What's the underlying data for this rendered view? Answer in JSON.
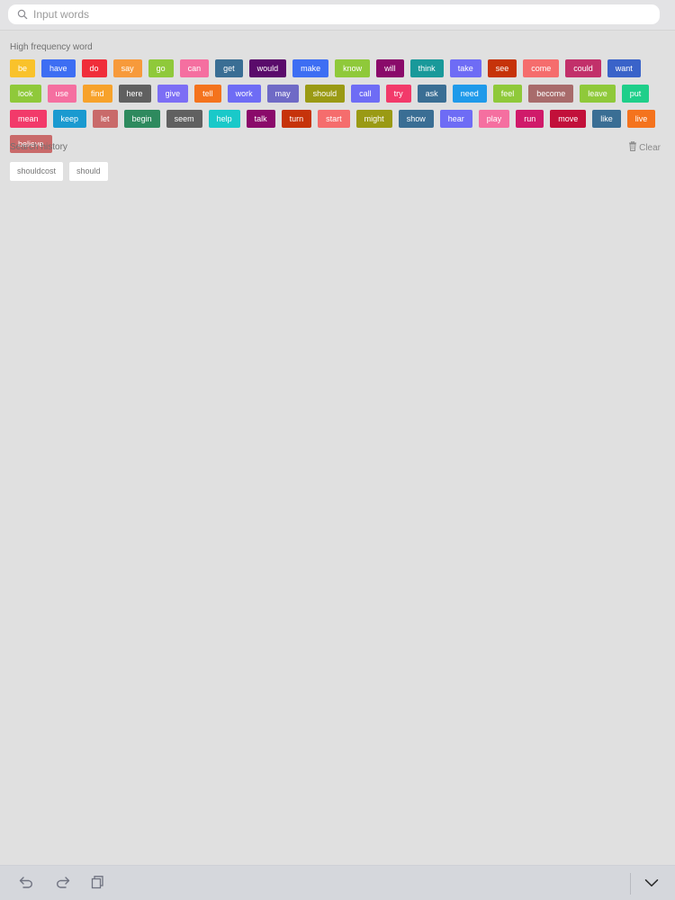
{
  "search": {
    "placeholder": "Input words",
    "value": ""
  },
  "high_frequency": {
    "title": "High frequency word",
    "words": [
      {
        "label": "be",
        "color": "#f9c22b"
      },
      {
        "label": "have",
        "color": "#3d6ef3"
      },
      {
        "label": "do",
        "color": "#f02e3a"
      },
      {
        "label": "say",
        "color": "#f79a3b"
      },
      {
        "label": "go",
        "color": "#8fc93a"
      },
      {
        "label": "can",
        "color": "#f56fa0"
      },
      {
        "label": "get",
        "color": "#3a6e94"
      },
      {
        "label": "would",
        "color": "#5a0b6b"
      },
      {
        "label": "make",
        "color": "#3d6ef3"
      },
      {
        "label": "know",
        "color": "#8fc93a"
      },
      {
        "label": "will",
        "color": "#8a0a6a"
      },
      {
        "label": "think",
        "color": "#19999a"
      },
      {
        "label": "take",
        "color": "#6e6cf5"
      },
      {
        "label": "see",
        "color": "#c6330a"
      },
      {
        "label": "come",
        "color": "#f56d6d"
      },
      {
        "label": "could",
        "color": "#c2306a"
      },
      {
        "label": "want",
        "color": "#3a63c9"
      },
      {
        "label": "look",
        "color": "#8fc93a"
      },
      {
        "label": "use",
        "color": "#f56fa0"
      },
      {
        "label": "find",
        "color": "#f7a22b"
      },
      {
        "label": "here",
        "color": "#606060"
      },
      {
        "label": "give",
        "color": "#7c6ef5"
      },
      {
        "label": "tell",
        "color": "#f4731d"
      },
      {
        "label": "work",
        "color": "#6e6cf5"
      },
      {
        "label": "may",
        "color": "#6f6ac6"
      },
      {
        "label": "should",
        "color": "#9a9a14"
      },
      {
        "label": "call",
        "color": "#6e6cf5"
      },
      {
        "label": "try",
        "color": "#f23a6a"
      },
      {
        "label": "ask",
        "color": "#3a6e94"
      },
      {
        "label": "need",
        "color": "#1f9aea"
      },
      {
        "label": "feel",
        "color": "#8fc93a"
      },
      {
        "label": "become",
        "color": "#a86b6b"
      },
      {
        "label": "leave",
        "color": "#8fc93a"
      },
      {
        "label": "put",
        "color": "#1fcf8a"
      },
      {
        "label": "mean",
        "color": "#f23a6a"
      },
      {
        "label": "keep",
        "color": "#1a9ad0"
      },
      {
        "label": "let",
        "color": "#c96a6a"
      },
      {
        "label": "begin",
        "color": "#2e8a5e"
      },
      {
        "label": "seem",
        "color": "#606060"
      },
      {
        "label": "help",
        "color": "#19c9c9"
      },
      {
        "label": "talk",
        "color": "#8a0a6a"
      },
      {
        "label": "turn",
        "color": "#c6330a"
      },
      {
        "label": "start",
        "color": "#f56d6d"
      },
      {
        "label": "might",
        "color": "#9a9a14"
      },
      {
        "label": "show",
        "color": "#3a6e94"
      },
      {
        "label": "hear",
        "color": "#6e6cf5"
      },
      {
        "label": "play",
        "color": "#f56fa0"
      },
      {
        "label": "run",
        "color": "#d01a6a"
      },
      {
        "label": "move",
        "color": "#c2103a"
      },
      {
        "label": "like",
        "color": "#3a6e94"
      },
      {
        "label": "live",
        "color": "#f4731d"
      },
      {
        "label": "believe",
        "color": "#c96a6a"
      }
    ]
  },
  "history": {
    "title": "Search history",
    "clear_label": "Clear",
    "items": [
      "shouldcost",
      "should"
    ]
  },
  "toolbar": {
    "icons": [
      "undo-icon",
      "redo-icon",
      "copy-icon",
      "chevron-down-icon"
    ]
  }
}
